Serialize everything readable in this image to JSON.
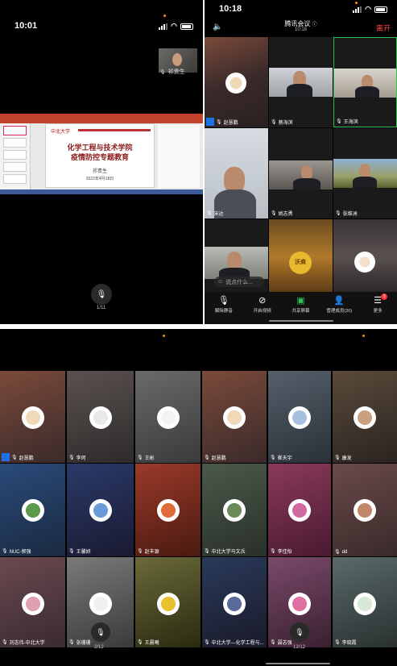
{
  "left": {
    "status_time": "10:01",
    "self_name": "祁贵生",
    "slide": {
      "logo_text": "中北大学",
      "title_line1": "化学工程与技术学院",
      "title_line2": "疫情防控专题教育",
      "author": "祁贵生",
      "date": "2022年4月18日"
    },
    "page_indicator": "1/11"
  },
  "right": {
    "status_time": "10:18",
    "meeting_title": "腾讯会议",
    "meeting_time": "10:18",
    "leave_label": "离开",
    "tiles": [
      {
        "name": "赵慧鹏"
      },
      {
        "name": "蔡海滨"
      },
      {
        "name": "王海滨"
      },
      {
        "name": "宋达"
      },
      {
        "name": "姚志勇"
      },
      {
        "name": "张维洲"
      },
      {
        "name": ""
      },
      {
        "name": ""
      },
      {
        "name": ""
      }
    ],
    "avatar_text": "沃商",
    "input_placeholder": "说点什么...",
    "controls": [
      {
        "label": "解除静音",
        "icon": "mic-off-icon"
      },
      {
        "label": "开启视频",
        "icon": "video-off-icon"
      },
      {
        "label": "共享屏幕",
        "icon": "share-screen-icon"
      },
      {
        "label": "管理成员(20)",
        "icon": "members-icon"
      },
      {
        "label": "更多",
        "icon": "more-icon"
      }
    ],
    "more_badge": "3"
  },
  "bottom": {
    "tiles": [
      {
        "name": "赵慧鹏"
      },
      {
        "name": "李珂"
      },
      {
        "name": "王彬"
      },
      {
        "name": "赵慧鹏"
      },
      {
        "name": "崔天宇"
      },
      {
        "name": "康发"
      },
      {
        "name": "NUC-郭强"
      },
      {
        "name": "王馨妍"
      },
      {
        "name": "赵丰源"
      },
      {
        "name": "中北大学马文兵"
      },
      {
        "name": "李佳怡"
      },
      {
        "name": "dd"
      },
      {
        "name": "刘志伟-中北大学"
      },
      {
        "name": "张珊珊"
      },
      {
        "name": "王晨曦"
      },
      {
        "name": "中北大学—化学工程与..."
      },
      {
        "name": "聂志强"
      },
      {
        "name": "李晓霞"
      }
    ],
    "page_left": "2/12",
    "page_right": "12/12"
  },
  "colors": {
    "leave_red": "#ff4a3d",
    "host_blue": "#1e6ff5",
    "active_green": "#33c15a",
    "slide_red": "#8b1a1a"
  }
}
